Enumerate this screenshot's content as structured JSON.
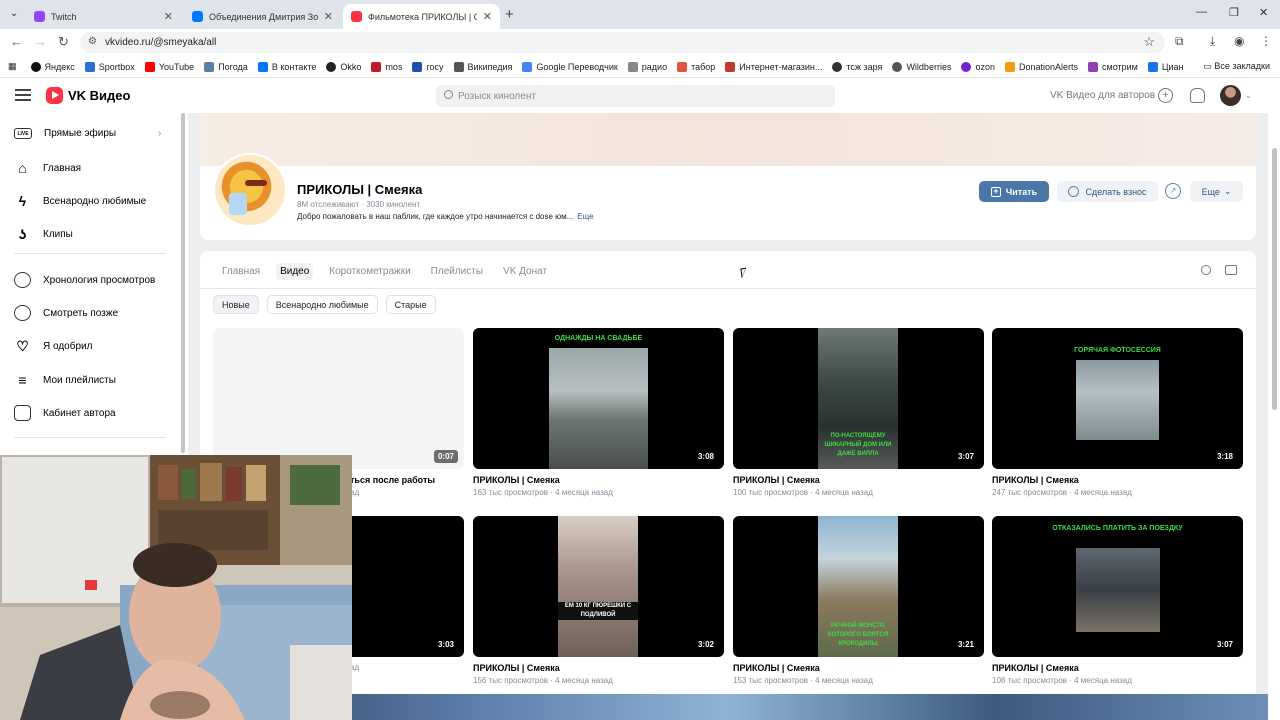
{
  "browser": {
    "tabs": [
      {
        "title": "Twitch",
        "color": "#9146ff"
      },
      {
        "title": "Объединения Дмитрия Зорин",
        "color": "#0077ff"
      },
      {
        "title": "Фильмотека ПРИКОЛЫ | Смея",
        "color": "#ff3347"
      }
    ],
    "url": "vkvideo.ru/@smeyaka/all",
    "bookmarks": [
      {
        "label": "Яндекс",
        "color": "#111"
      },
      {
        "label": "Sportbox",
        "color": "#2a6fd6"
      },
      {
        "label": "YouTube",
        "color": "#ff0000"
      },
      {
        "label": "Погода",
        "color": "#5a7fa0"
      },
      {
        "label": "В контакте",
        "color": "#0077ff"
      },
      {
        "label": "Okko",
        "color": "#222"
      },
      {
        "label": "mos",
        "color": "#c0182b"
      },
      {
        "label": "госу",
        "color": "#1f4fa8"
      },
      {
        "label": "Википедия",
        "color": "#555"
      },
      {
        "label": "Google Переводчик",
        "color": "#4285f4"
      },
      {
        "label": "радио",
        "color": "#888"
      },
      {
        "label": "табор",
        "color": "#e2533f"
      },
      {
        "label": "Интернет-магазин...",
        "color": "#c0392b"
      },
      {
        "label": "тсж заря",
        "color": "#333"
      },
      {
        "label": "Wildberries",
        "color": "#555"
      },
      {
        "label": "ozon",
        "color": "#7a1fd1"
      },
      {
        "label": "DonationAlerts",
        "color": "#f39c12"
      },
      {
        "label": "смотрим",
        "color": "#8e44ad"
      },
      {
        "label": "Циан",
        "color": "#1a73e8"
      }
    ],
    "all_bookmarks": "Все закладки"
  },
  "header": {
    "brand": "VK Видео",
    "search_placeholder": "Розыск кинолент",
    "authors_link": "VK Видео для авторов"
  },
  "sidebar": {
    "items": [
      {
        "label": "Прямые эфиры",
        "icon": "live-icon"
      },
      {
        "label": "Главная",
        "icon": "home-icon"
      },
      {
        "label": "Всенародно любимые",
        "icon": "flash-icon"
      },
      {
        "label": "Клипы",
        "icon": "clips-icon"
      },
      {
        "label": "Хронология просмотров",
        "icon": "history-icon"
      },
      {
        "label": "Смотреть позже",
        "icon": "clock-icon"
      },
      {
        "label": "Я одобрил",
        "icon": "heart-icon"
      },
      {
        "label": "Мои плейлисты",
        "icon": "playlist-icon"
      },
      {
        "label": "Кабинет автора",
        "icon": "studio-icon"
      }
    ]
  },
  "channel": {
    "name": "ПРИКОЛЫ | Смеяка",
    "meta": "8M отслеживают · 3030 кинолент",
    "description": "Добро пожаловать в наш паблик, где каждое утро начинается с dose юм...",
    "more": "Еще",
    "read_button": "Читать",
    "donate_button": "Сделать взнос",
    "more_button": "Еще"
  },
  "tabs": [
    "Главная",
    "Видео",
    "Короткометражки",
    "Плейлисты",
    "VK Донат"
  ],
  "active_tab": "Видео",
  "filters": [
    "Новые",
    "Всенародно любимые",
    "Старые"
  ],
  "active_filter": "Новые",
  "videos": [
    {
      "title": "ться после работы",
      "meta": "ад",
      "duration": "0:07",
      "caption": ""
    },
    {
      "title": "ПРИКОЛЫ | Смеяка",
      "meta": "163 тыс просмотров · 4 месяца назад",
      "duration": "3:08",
      "caption": "ОДНАЖДЫ НА СВАДЬБЕ"
    },
    {
      "title": "ПРИКОЛЫ | Смеяка",
      "meta": "100 тыс просмотров · 4 месяца назад",
      "duration": "3:07",
      "caption": "ПО-НАСТОЯЩЕМУ ШИКАРНЫЙ ДОМ ИЛИ ДАЖЕ ВИЛЛА"
    },
    {
      "title": "ПРИКОЛЫ | Смеяка",
      "meta": "247 тыс просмотров · 4 месяца назад",
      "duration": "3:18",
      "caption": "ГОРЯЧАЯ ФОТОСЕССИЯ"
    },
    {
      "title": "",
      "meta": "ад",
      "duration": "3:03",
      "caption": ""
    },
    {
      "title": "ПРИКОЛЫ | Смеяка",
      "meta": "156 тыс просмотров · 4 месяца назад",
      "duration": "3:02",
      "caption": "ЕМ 10 КГ ПЮРЕШКИ С ПОДЛИВОЙ"
    },
    {
      "title": "ПРИКОЛЫ | Смеяка",
      "meta": "153 тыс просмотров · 4 месяца назад",
      "duration": "3:21",
      "caption": "РЕЧНОЙ МОНСТР, КОТОРОГО БОЯТСЯ КРОКОДИЛЫ"
    },
    {
      "title": "ПРИКОЛЫ | Смеяка",
      "meta": "108 тыс просмотров · 4 месяца назад",
      "duration": "3:07",
      "caption": "ОТКАЗАЛИСЬ ПЛАТИТЬ ЗА ПОЕЗДКУ"
    }
  ]
}
